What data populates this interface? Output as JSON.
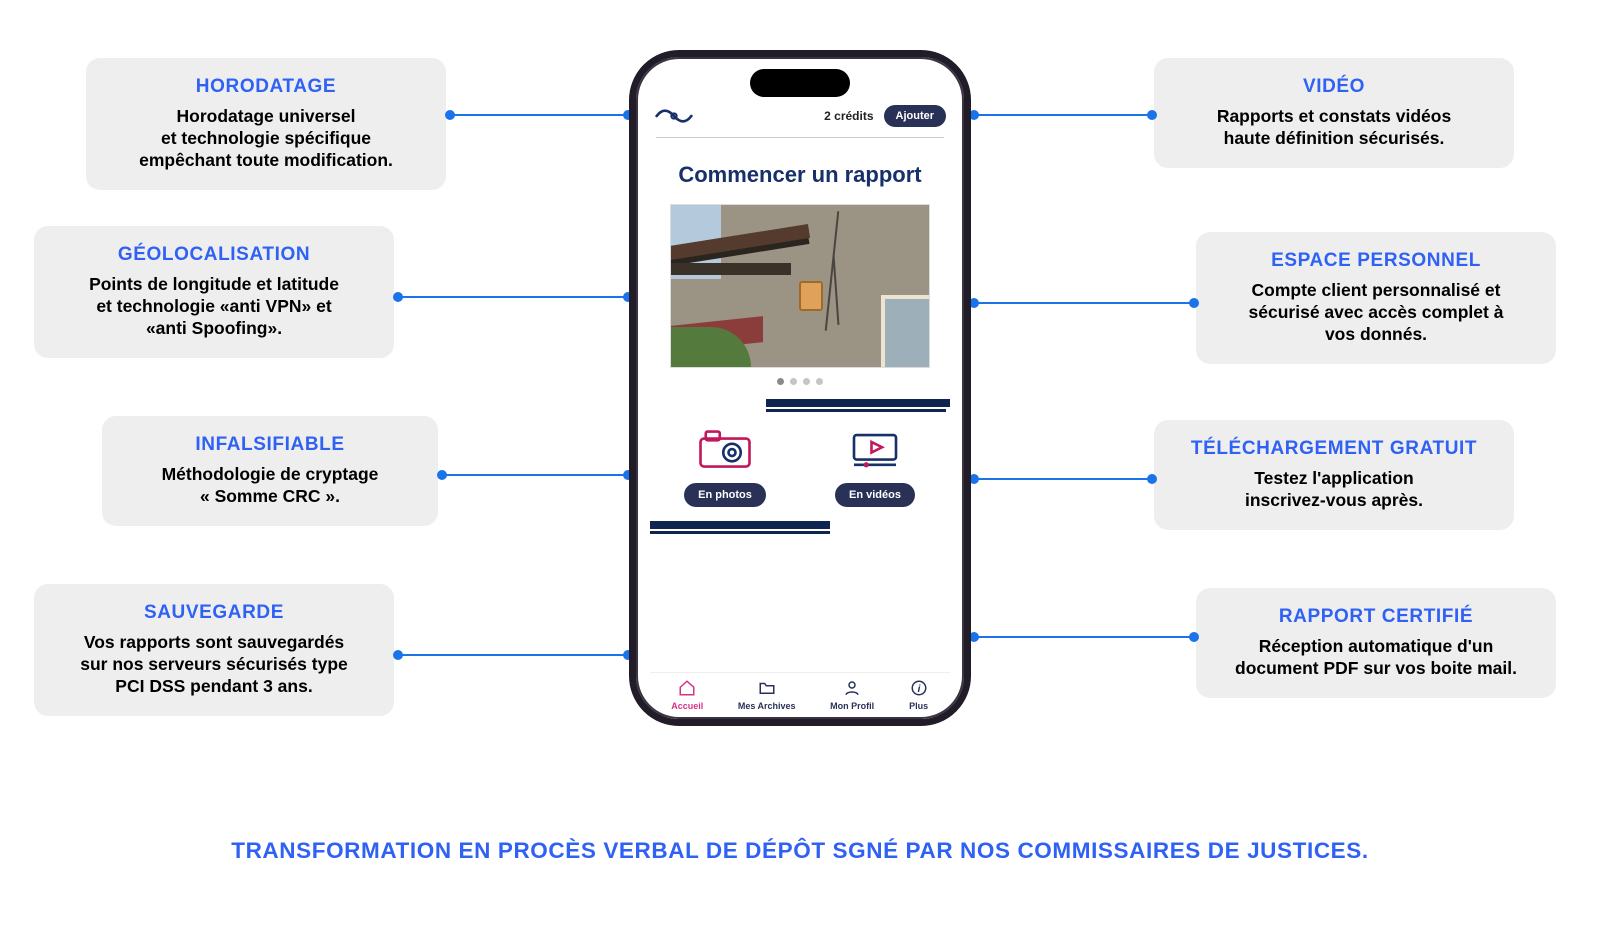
{
  "features_left": [
    {
      "title": "HORODATAGE",
      "desc": "Horodatage universel\net technologie spécifique\nempêchant toute modification."
    },
    {
      "title": "GÉOLOCALISATION",
      "desc": "Points de longitude et latitude\net technologie «anti VPN» et\n«anti Spoofing»."
    },
    {
      "title": "INFALSIFIABLE",
      "desc": "Méthodologie de cryptage\n« Somme CRC »."
    },
    {
      "title": "SAUVEGARDE",
      "desc": "Vos rapports sont sauvegardés\nsur nos serveurs sécurisés type\nPCI DSS pendant 3 ans."
    }
  ],
  "features_right": [
    {
      "title": "VIDÉO",
      "desc": "Rapports et constats vidéos\nhaute définition sécurisés."
    },
    {
      "title": "ESPACE PERSONNEL",
      "desc": "Compte client personnalisé et\nsécurisé avec accès complet à\nvos donnés."
    },
    {
      "title": "TÉLÉCHARGEMENT GRATUIT",
      "desc": "Testez l'application\ninscrivez-vous après."
    },
    {
      "title": "RAPPORT CERTIFIÉ",
      "desc": "Réception automatique d'un\ndocument PDF sur vos boite mail."
    }
  ],
  "phone": {
    "credits": "2 crédits",
    "add": "Ajouter",
    "title": "Commencer un rapport",
    "action_photo": "En photos",
    "action_video": "En vidéos",
    "nav": {
      "home": "Accueil",
      "arch": "Mes Archives",
      "profile": "Mon Profil",
      "more": "Plus"
    }
  },
  "footer": "TRANSFORMATION EN PROCÈS VERBAL DE DÉPÔT SGNÉ PAR NOS COMMISSAIRES DE JUSTICES."
}
